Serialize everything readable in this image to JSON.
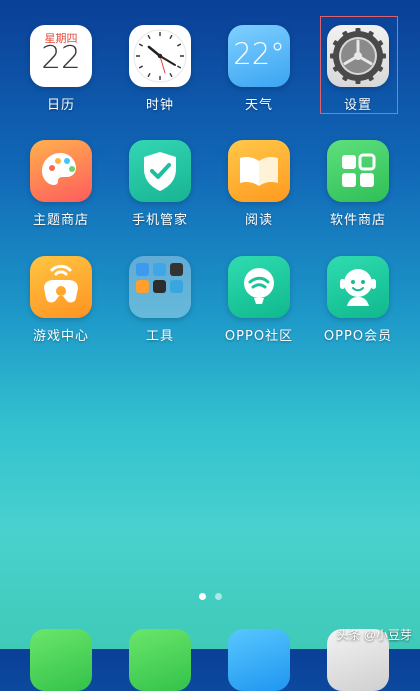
{
  "apps": {
    "calendar": {
      "label": "日历",
      "weekday": "星期四",
      "day": "22"
    },
    "clock": {
      "label": "时钟"
    },
    "weather": {
      "label": "天气",
      "temperature": "22°"
    },
    "settings": {
      "label": "设置"
    },
    "theme_store": {
      "label": "主题商店"
    },
    "phone_manager": {
      "label": "手机管家"
    },
    "reader": {
      "label": "阅读"
    },
    "software_store": {
      "label": "软件商店"
    },
    "game_center": {
      "label": "游戏中心"
    },
    "tools": {
      "label": "工具"
    },
    "oppo_community": {
      "label": "OPPO社区"
    },
    "oppo_member": {
      "label": "OPPO会员"
    }
  },
  "pager": {
    "pages": 2,
    "current": 1
  },
  "watermark": "头条 @小豆芽",
  "colors": {
    "selection_frame": "#e0616a",
    "calendar_weekday": "#e34b3c"
  }
}
